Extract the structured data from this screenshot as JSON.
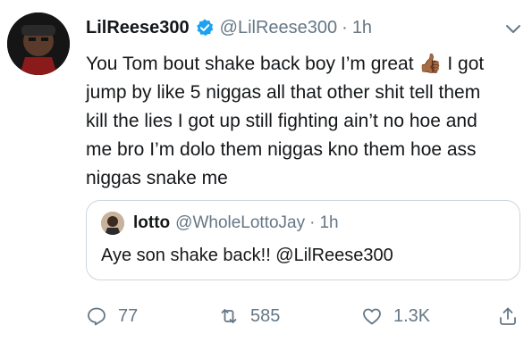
{
  "tweet": {
    "author": {
      "name": "LilReese300",
      "handle": "@LilReese300",
      "verified": true,
      "avatar": "profile-photo"
    },
    "time_separator": "·",
    "time": "1h",
    "text": "You Tom bout shake back boy I’m great 👍🏾 I got jump by like 5 niggas all that other shit tell them kill the lies  I got up still fighting ain’t no hoe and me bro I’m dolo them niggas kno them hoe ass niggas snake me",
    "quoted": {
      "author": {
        "name": "lotto",
        "handle": "@WholeLottoJay",
        "avatar": "profile-photo"
      },
      "time_separator": "·",
      "time": "1h",
      "text": "Aye son shake back!! @LilReese300"
    },
    "actions": {
      "replies": "77",
      "retweets": "585",
      "likes": "1.3K"
    }
  },
  "colors": {
    "text": "#14171a",
    "secondary": "#657786",
    "verified_blue": "#1da1f2",
    "border": "#ccd6dd"
  },
  "icons": [
    "verified-badge-icon",
    "chevron-down-icon",
    "reply-icon",
    "retweet-icon",
    "like-icon",
    "share-icon"
  ]
}
